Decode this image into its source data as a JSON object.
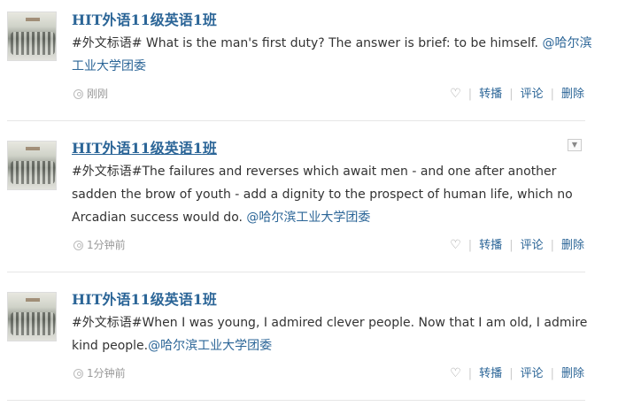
{
  "posts": [
    {
      "author": "HIT外语11级英语1班",
      "text_parts": [
        {
          "t": "#外文标语# What is the man's first duty? The answer is brief: to be himself. ",
          "link": false
        },
        {
          "t": "@哈尔滨工业大学团委",
          "link": true
        }
      ],
      "time": "刚刚",
      "actions": {
        "like_icon": "heart-icon",
        "repost": "转播",
        "comment": "评论",
        "delete": "删除"
      }
    },
    {
      "author": "HIT外语11级英语1班",
      "text_parts": [
        {
          "t": "#外文标语#The failures and reverses which await men - and one after another sadden the brow of youth - add a dignity to the prospect of human life, which no Arcadian success would do. ",
          "link": false
        },
        {
          "t": "@哈尔滨工业大学团委",
          "link": true
        }
      ],
      "time": "1分钟前",
      "actions": {
        "like_icon": "heart-icon",
        "repost": "转播",
        "comment": "评论",
        "delete": "删除"
      }
    },
    {
      "author": "HIT外语11级英语1班",
      "text_parts": [
        {
          "t": "#外文标语#When I was young, I admired clever people. Now that I am old, I admire kind people.",
          "link": false
        },
        {
          "t": "@哈尔滨工业大学团委",
          "link": true
        }
      ],
      "time": "1分钟前",
      "actions": {
        "like_icon": "heart-icon",
        "repost": "转播",
        "comment": "评论",
        "delete": "删除"
      }
    }
  ]
}
